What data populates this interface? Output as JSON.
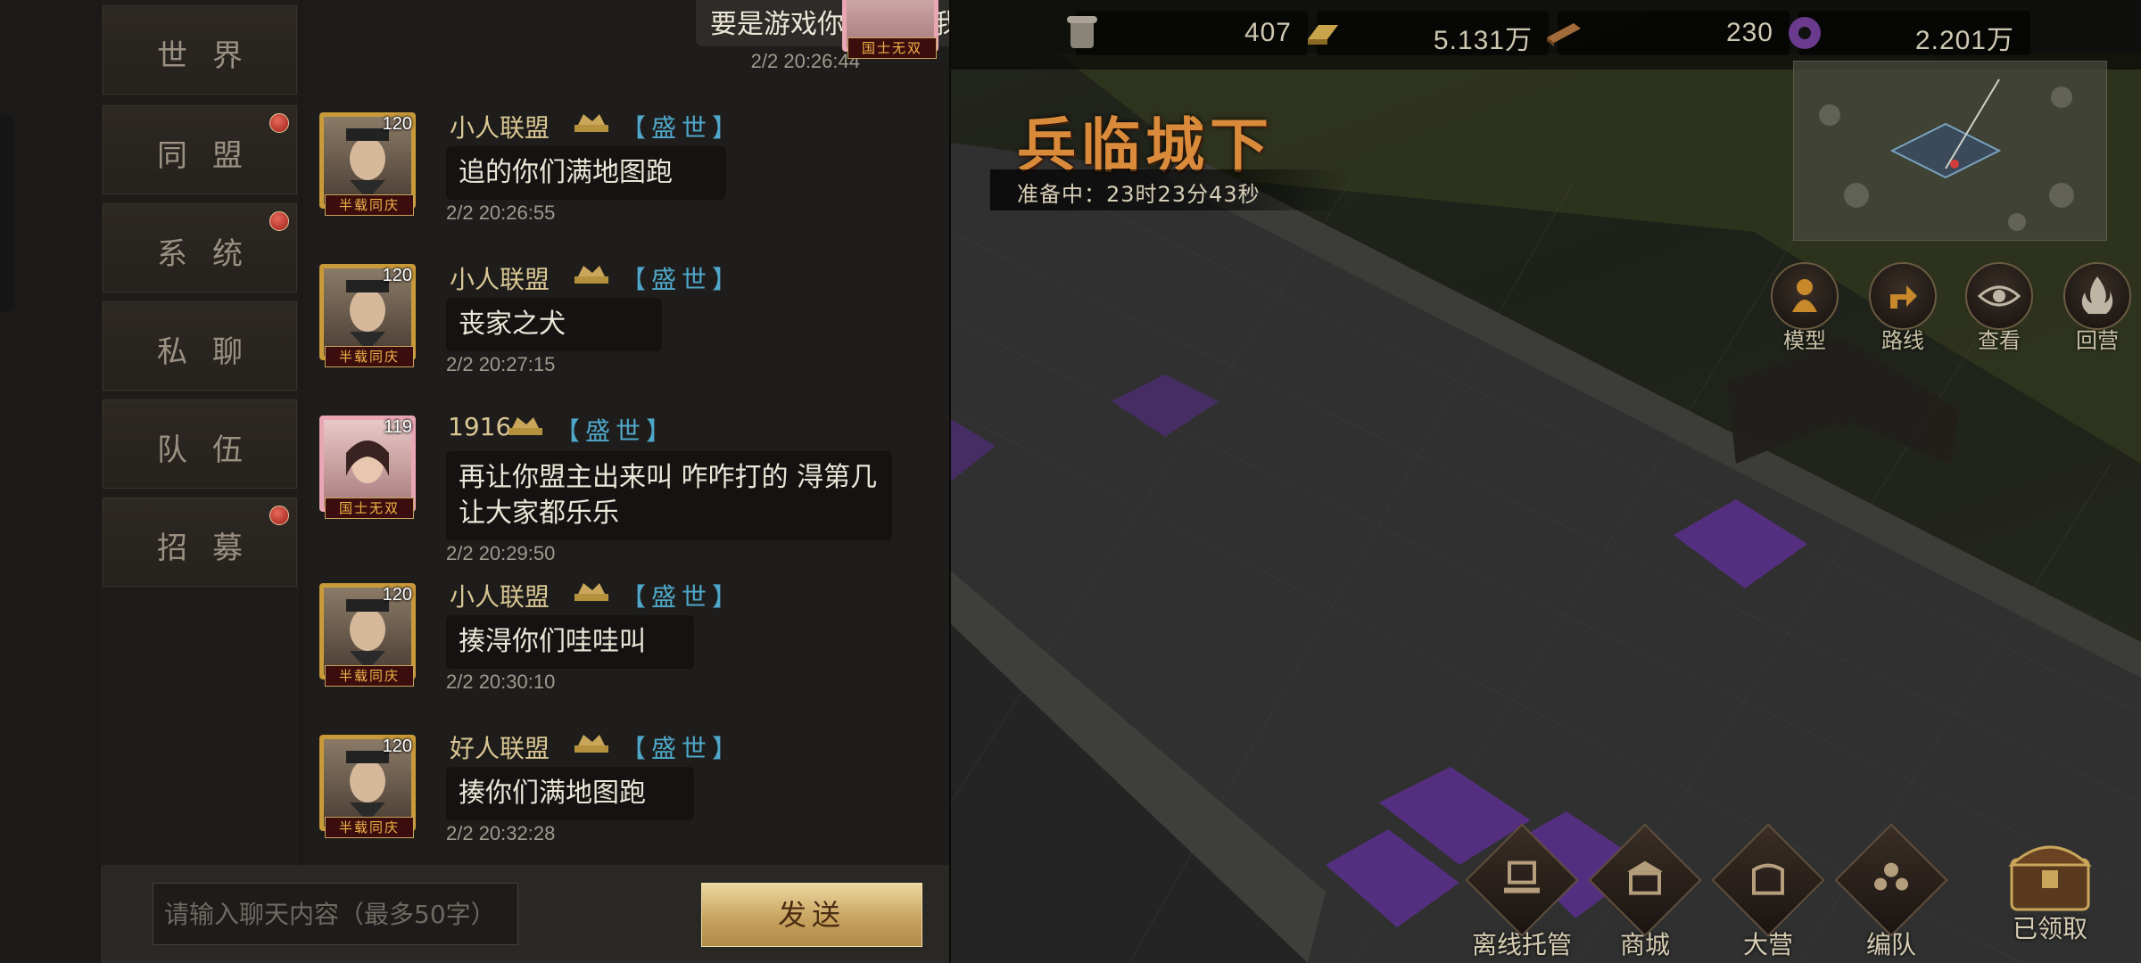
{
  "resources": [
    {
      "icon": "scroll-icon",
      "value": "407"
    },
    {
      "icon": "gold-bar-icon",
      "value": "5.131万"
    },
    {
      "icon": "wood-icon",
      "value": "230"
    },
    {
      "icon": "jade-coin-icon",
      "value": "2.201万"
    }
  ],
  "event": {
    "title": "兵临城下",
    "timer": "准备中：23时23分43秒"
  },
  "actions": [
    {
      "icon": "model-icon",
      "label": "模型"
    },
    {
      "icon": "route-icon",
      "label": "路线"
    },
    {
      "icon": "eye-icon",
      "label": "查看"
    },
    {
      "icon": "fire-icon",
      "label": "回营"
    }
  ],
  "bottom_nav": [
    {
      "icon": "offline-host-icon",
      "label": "离线托管"
    },
    {
      "icon": "shop-icon",
      "label": "商城"
    },
    {
      "icon": "camp-icon",
      "label": "大营"
    },
    {
      "icon": "formation-icon",
      "label": "编队"
    },
    {
      "icon": "treasure-chest-icon",
      "label": "已领取"
    }
  ],
  "tabs": [
    {
      "label": "世界",
      "active": true,
      "dot": false
    },
    {
      "label": "同盟",
      "active": false,
      "dot": true
    },
    {
      "label": "系统",
      "active": false,
      "dot": true
    },
    {
      "label": "私聊",
      "active": false,
      "dot": false
    },
    {
      "label": "队伍",
      "active": false,
      "dot": false
    },
    {
      "label": "招募",
      "active": false,
      "dot": true
    }
  ],
  "chat": {
    "top_message": {
      "text": "要是游戏你家的 把我封号吧",
      "time": "2/2 20:26:44",
      "tag": "国士无双"
    },
    "messages": [
      {
        "name": "小人联盟",
        "tribe": "【盛世】",
        "level": "120",
        "tag": "半载同庆",
        "text": "追的你们满地图跑",
        "time": "2/2 20:26:55"
      },
      {
        "name": "小人联盟",
        "tribe": "【盛世】",
        "level": "120",
        "tag": "半载同庆",
        "text": "丧家之犬",
        "time": "2/2 20:27:15"
      },
      {
        "name": "1916",
        "tribe": "【盛世】",
        "level": "119",
        "tag": "国士无双",
        "text": "再让你盟主出来叫 咋咋打的 淂第几 让大家都乐乐",
        "time": "2/2 20:29:50"
      },
      {
        "name": "小人联盟",
        "tribe": "【盛世】",
        "level": "120",
        "tag": "半载同庆",
        "text": "揍淂你们哇哇叫",
        "time": "2/2 20:30:10"
      },
      {
        "name": "好人联盟",
        "tribe": "【盛世】",
        "level": "120",
        "tag": "半载同庆",
        "text": "揍你们满地图跑",
        "time": "2/2 20:32:28"
      }
    ]
  },
  "input": {
    "placeholder": "请输入聊天内容（最多50字）",
    "send_label": "发送"
  },
  "colors": {
    "accent_gold": "#c9a65a",
    "tribe_blue": "#4fa7c9",
    "event_orange": "#d98a3a",
    "badge_red": "#b5261f"
  }
}
